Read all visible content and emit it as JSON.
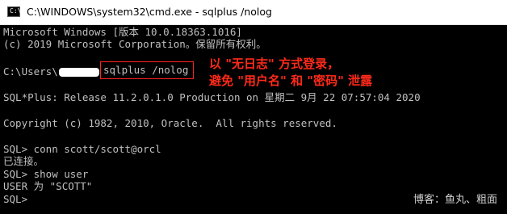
{
  "window": {
    "title": "C:\\WINDOWS\\system32\\cmd.exe - sqlplus  /nolog",
    "icon": "cmd-prompt-icon",
    "icon_glyph": "C:\\"
  },
  "console": {
    "lines": [
      "Microsoft Windows [版本 10.0.18363.1016]",
      "(c) 2019 Microsoft Corporation。保留所有权利。",
      "C:\\Users\\",
      "SQL*Plus: Release 11.2.0.1.0 Production on 星期二 9月 22 07:57:04 2020",
      "Copyright (c) 1982, 2010, Oracle.  All rights reserved.",
      "SQL> conn scott/scott@orcl",
      "已连接。",
      "SQL> show user",
      "USER 为 \"SCOTT\"",
      "SQL>"
    ],
    "highlighted_command": "sqlplus /nolog",
    "redacted_username": "redacted-username"
  },
  "annotation": {
    "line1": "以 \"无日志\" 方式登录，",
    "line2": "避免 \"用户名\" 和 \"密码\" 泄露",
    "color": "#ff2a1a"
  },
  "watermark": "博客：鱼丸、粗面",
  "colors": {
    "console_bg": "#000000",
    "console_fg": "#c0c0c0",
    "highlight_border": "#ff2020"
  }
}
